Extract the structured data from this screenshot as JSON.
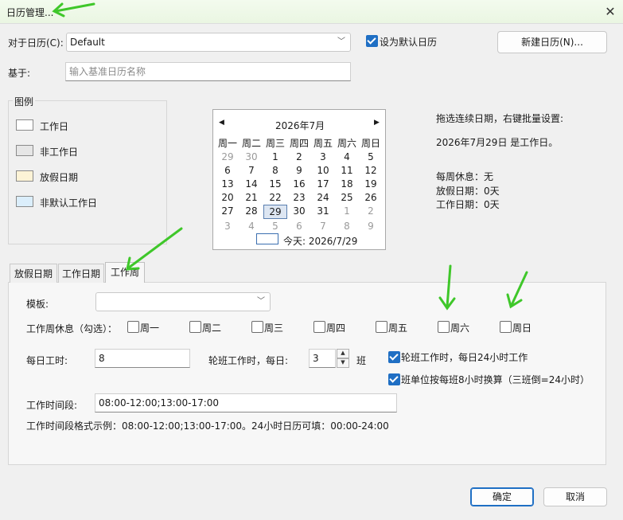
{
  "window": {
    "title": "日历管理...",
    "close_icon": "close-icon"
  },
  "header": {
    "calendar_label": "对于日历(C):",
    "calendar_value": "Default",
    "default_checkbox_label": "设为默认日历",
    "default_checked": true,
    "new_calendar_button": "新建日历(N)...",
    "base_label": "基于:",
    "base_placeholder": "输入基准日历名称"
  },
  "legend": {
    "title": "图例",
    "items": [
      {
        "label": "工作日",
        "color": "#ffffff"
      },
      {
        "label": "非工作日",
        "color": "#e6e6e6"
      },
      {
        "label": "放假日期",
        "color": "#fdf3d6"
      },
      {
        "label": "非默认工作日",
        "color": "#dbeefb"
      }
    ]
  },
  "calendar": {
    "month_title": "2026年7月",
    "prev_icon": "chevron-left-icon",
    "next_icon": "chevron-right-icon",
    "weekdays": [
      "周一",
      "周二",
      "周三",
      "周四",
      "周五",
      "周六",
      "周日"
    ],
    "weeks": [
      [
        "29",
        "30",
        "1",
        "2",
        "3",
        "4",
        "5"
      ],
      [
        "6",
        "7",
        "8",
        "9",
        "10",
        "11",
        "12"
      ],
      [
        "13",
        "14",
        "15",
        "16",
        "17",
        "18",
        "19"
      ],
      [
        "20",
        "21",
        "22",
        "23",
        "24",
        "25",
        "26"
      ],
      [
        "27",
        "28",
        "29",
        "30",
        "31",
        "1",
        "2"
      ],
      [
        "3",
        "4",
        "5",
        "6",
        "7",
        "8",
        "9"
      ]
    ],
    "other_month_flags": [
      [
        true,
        true,
        false,
        false,
        false,
        false,
        false
      ],
      [
        false,
        false,
        false,
        false,
        false,
        false,
        false
      ],
      [
        false,
        false,
        false,
        false,
        false,
        false,
        false
      ],
      [
        false,
        false,
        false,
        false,
        false,
        false,
        false
      ],
      [
        false,
        false,
        false,
        false,
        false,
        true,
        true
      ],
      [
        true,
        true,
        true,
        true,
        true,
        true,
        true
      ]
    ],
    "selected_day": "29",
    "today_label": "今天: 2026/7/29"
  },
  "info": {
    "hint": "拖选连续日期，右键批量设置:",
    "selected_status": "2026年7月29日 是工作日。",
    "weekly_rest": "每周休息：无",
    "holidays": "放假日期：0天",
    "workdays": "工作日期：0天"
  },
  "tabs": [
    "放假日期",
    "工作日期",
    "工作周"
  ],
  "active_tab": "工作周",
  "workweek": {
    "template_label": "模板:",
    "template_value": "",
    "rest_label": "工作周休息（勾选）：",
    "days": [
      {
        "label": "周一",
        "checked": false
      },
      {
        "label": "周二",
        "checked": false
      },
      {
        "label": "周三",
        "checked": false
      },
      {
        "label": "周四",
        "checked": false
      },
      {
        "label": "周五",
        "checked": false
      },
      {
        "label": "周六",
        "checked": false
      },
      {
        "label": "周日",
        "checked": false
      }
    ],
    "daily_hours_label": "每日工时:",
    "daily_hours_value": "8",
    "shift_label": "轮班工作时，每日:",
    "shift_value": "3",
    "shift_unit": "班",
    "shift24_label": "轮班工作时，每日24小时工作",
    "shift24_checked": true,
    "shift_calc_label": "班单位按每班8小时换算（三班倒=24小时）",
    "shift_calc_checked": true,
    "periods_label": "工作时间段:",
    "periods_value": "08:00-12:00;13:00-17:00",
    "format_hint": "工作时间段格式示例：08:00-12:00;13:00-17:00。24小时日历可填：00:00-24:00"
  },
  "footer": {
    "ok": "确定",
    "cancel": "取消"
  },
  "annotation_color": "#3fc72a"
}
